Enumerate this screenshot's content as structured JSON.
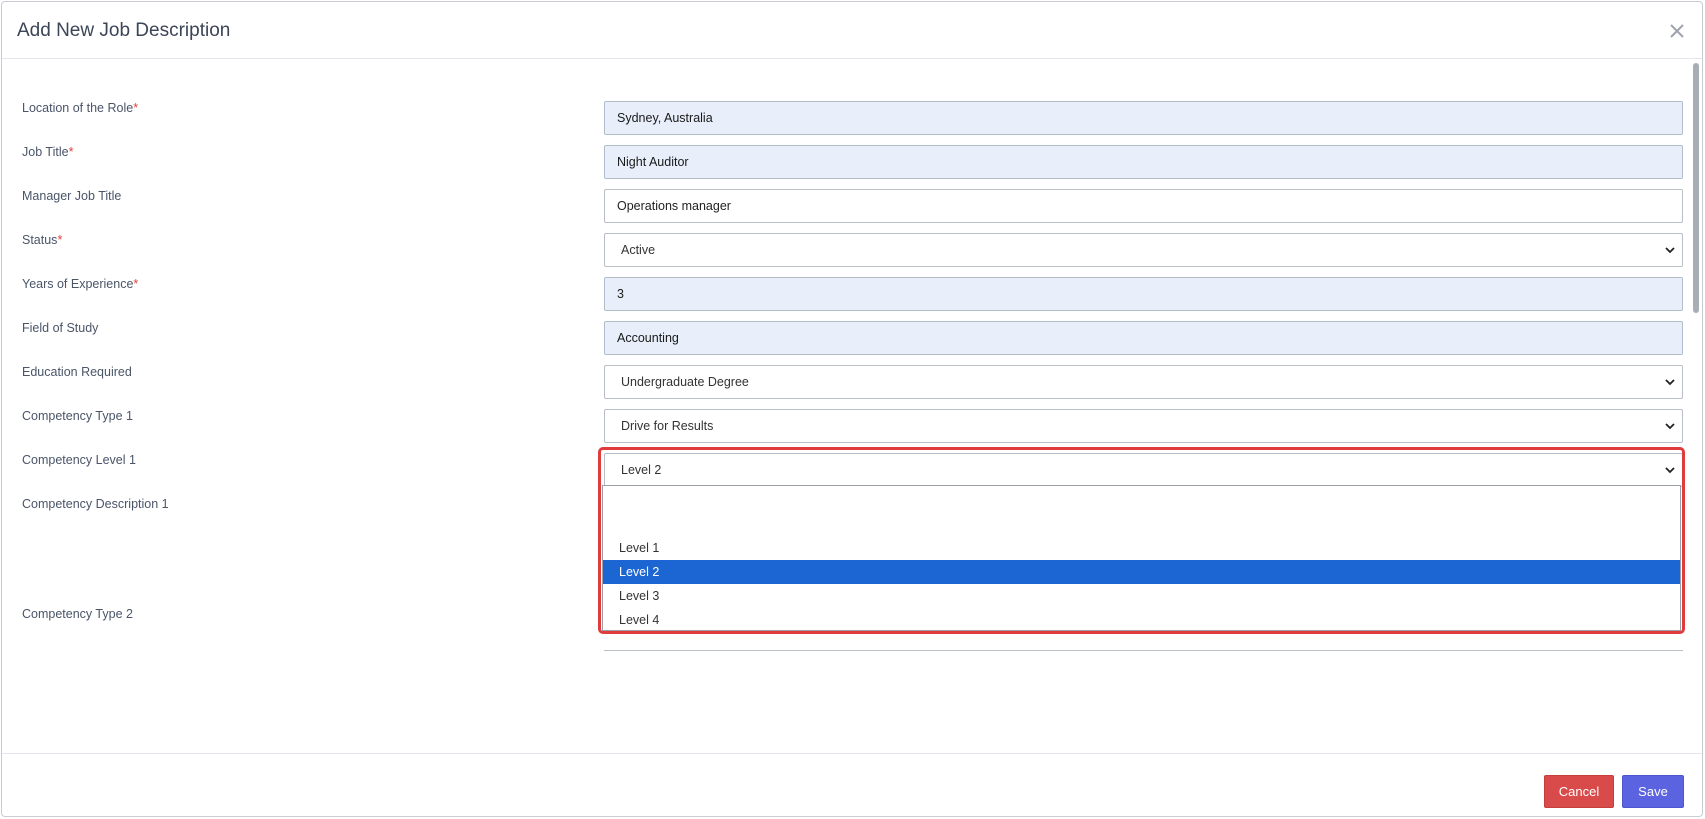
{
  "modal": {
    "title": "Add New Job Description"
  },
  "fields": {
    "location_label": "Location of the Role",
    "location_value": "Sydney, Australia",
    "job_title_label": "Job Title",
    "job_title_value": "Night Auditor",
    "manager_label": "Manager Job Title",
    "manager_value": "Operations manager",
    "status_label": "Status",
    "status_value": "Active",
    "years_label": "Years of Experience",
    "years_value": "3",
    "field_of_study_label": "Field of Study",
    "field_of_study_value": "Accounting",
    "education_label": "Education Required",
    "education_value": "Undergraduate Degree",
    "comp_type1_label": "Competency Type 1",
    "comp_type1_value": "Drive for Results",
    "comp_level1_label": "Competency Level 1",
    "comp_level1_value": "Level 2",
    "comp_desc1_label": "Competency Description 1",
    "comp_type2_label": "Competency Type 2",
    "required_marker": "*"
  },
  "dropdown": {
    "options": [
      "Level 1",
      "Level 2",
      "Level 3",
      "Level 4"
    ],
    "selected": "Level 2"
  },
  "footer": {
    "cancel_label": "Cancel",
    "save_label": "Save"
  },
  "colors": {
    "highlight": "#e03c3c",
    "selected_option": "#1b66d2",
    "cancel": "#d94a4a",
    "save": "#5b63e0",
    "filled_field": "#e8effb"
  }
}
